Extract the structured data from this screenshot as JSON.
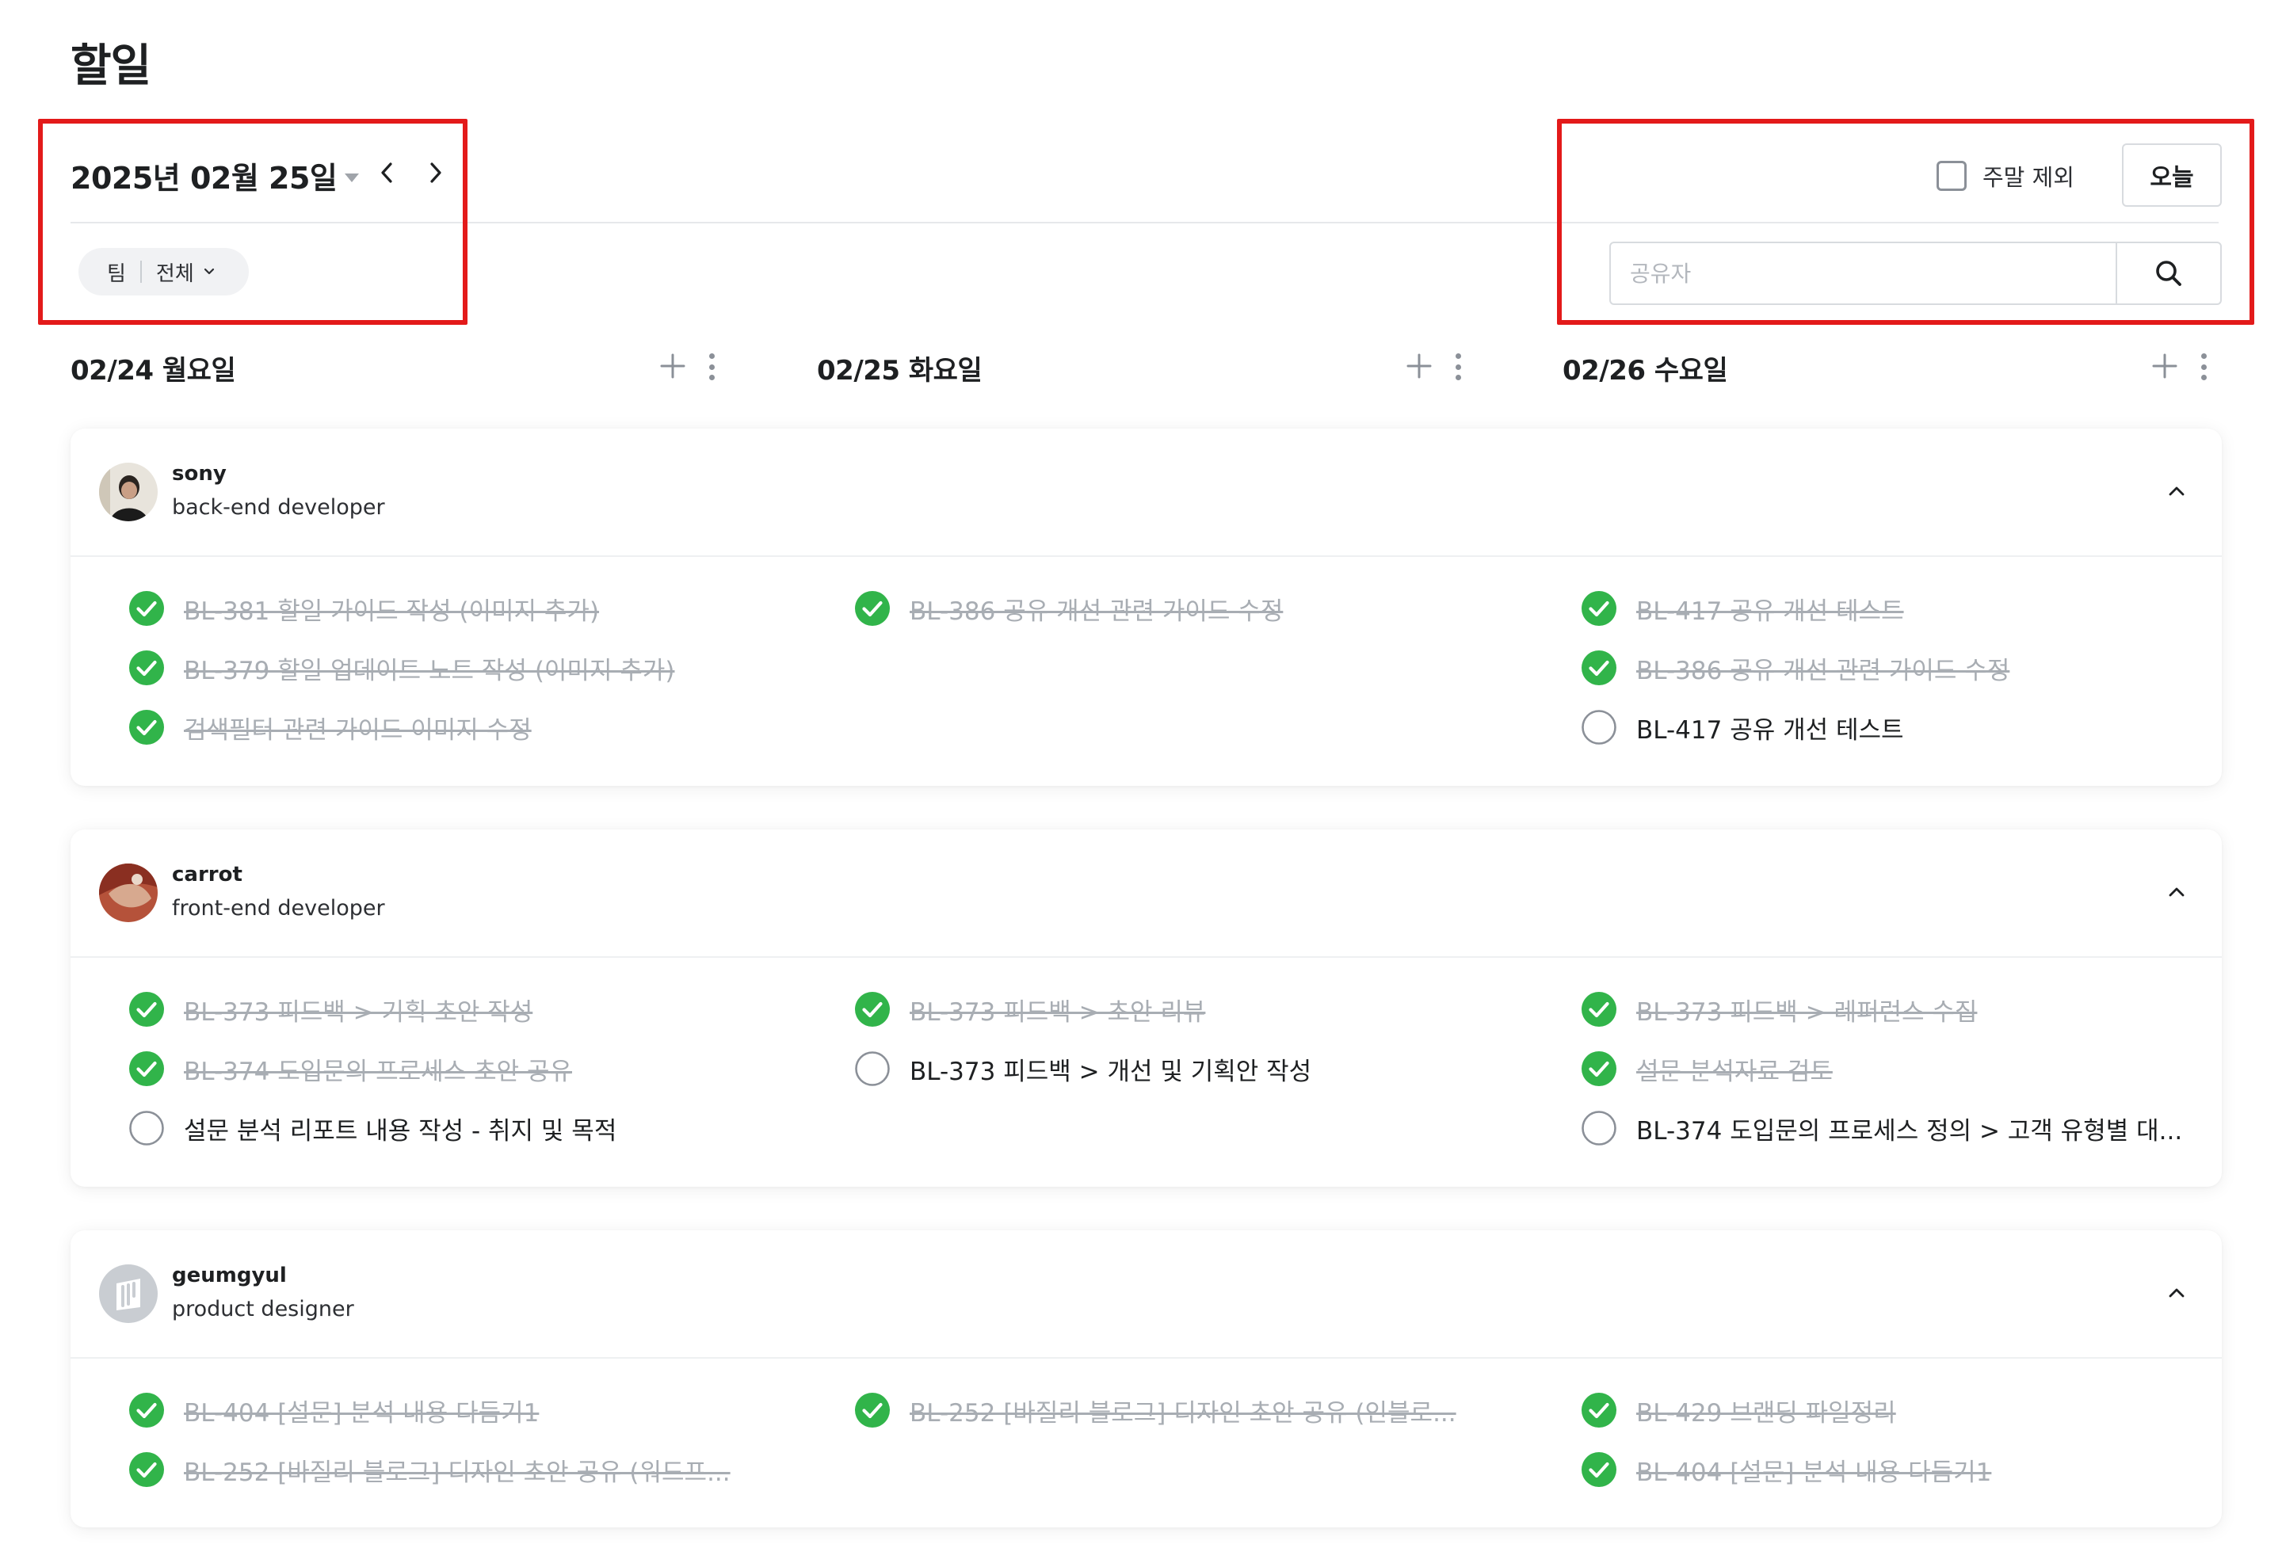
{
  "page_title": "할일",
  "date_picker": {
    "label": "2025년 02월 25일"
  },
  "team_filter": {
    "label": "팀",
    "value": "전체"
  },
  "weekend_exclude_label": "주말 제외",
  "today_button": "오늘",
  "search": {
    "placeholder": "공유자"
  },
  "days": [
    {
      "label": "02/24 월요일"
    },
    {
      "label": "02/25 화요일"
    },
    {
      "label": "02/26 수요일"
    }
  ],
  "members": [
    {
      "name": "sony",
      "role": "back-end developer",
      "tasks": [
        [
          {
            "text": "BL-381 할일 가이드 작성 (이미지 추가)",
            "done": true
          },
          {
            "text": "BL-379 할일 업데이트 노트 작성 (이미지 추가)",
            "done": true
          },
          {
            "text": "검색필터 관련 가이드 이미지 수정",
            "done": true
          }
        ],
        [
          {
            "text": "BL-386 공유 개선 관련 가이드 수정",
            "done": true
          }
        ],
        [
          {
            "text": "BL-417 공유 개선 테스트",
            "done": true
          },
          {
            "text": "BL-386 공유 개선 관련 가이드 수정",
            "done": true
          },
          {
            "text": "BL-417 공유 개선 테스트",
            "done": false
          }
        ]
      ]
    },
    {
      "name": "carrot",
      "role": "front-end developer",
      "tasks": [
        [
          {
            "text": "BL-373 피드백 > 기획 초안 작성",
            "done": true
          },
          {
            "text": "BL-374 도입문의 프로세스 초안 공유",
            "done": true
          },
          {
            "text": "설문 분석 리포트 내용 작성 - 취지 및 목적",
            "done": false
          }
        ],
        [
          {
            "text": "BL-373 피드백 > 초안 리뷰",
            "done": true
          },
          {
            "text": "BL-373 피드백 > 개선 및 기획안 작성",
            "done": false
          }
        ],
        [
          {
            "text": "BL-373 피드백 > 레퍼런스 수집",
            "done": true
          },
          {
            "text": "설문 분석자료 검토",
            "done": true
          },
          {
            "text": "BL-374 도입문의 프로세스 정의 > 고객 유형별 대...",
            "done": false
          }
        ]
      ]
    },
    {
      "name": "geumgyul",
      "role": "product designer",
      "tasks": [
        [
          {
            "text": "BL-404 [설문] 분석 내용 다듬기1",
            "done": true
          },
          {
            "text": "BL-252 [바질리 블로그] 디자인 초안 공유 (워드프...",
            "done": true
          }
        ],
        [
          {
            "text": "BL-252 [바질리 블로그] 디자인 초안 공유 (인블로...",
            "done": true
          }
        ],
        [
          {
            "text": "BL-429 브랜딩 파일정리",
            "done": true
          },
          {
            "text": "BL-404 [설문] 분석 내용 다듬기1",
            "done": true
          }
        ]
      ]
    }
  ],
  "icons": {
    "done": "check-circle-icon",
    "todo": "empty-circle-icon",
    "nav": [
      "chevron-left-icon",
      "chevron-right-icon"
    ],
    "search": "search-icon",
    "collapse": "chevron-up-icon"
  },
  "colors": {
    "done_green": "#31b44a",
    "highlight_red": "#e31a1a",
    "done_text": "#a8adb3"
  }
}
